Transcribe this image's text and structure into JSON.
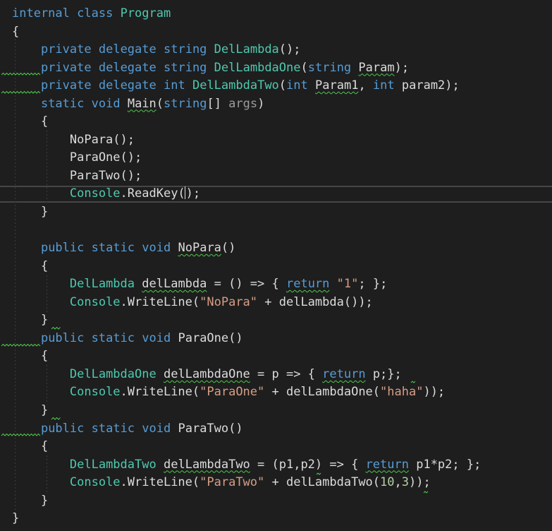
{
  "editor": {
    "lines": [
      [
        {
          "t": "internal",
          "c": "kw"
        },
        {
          "t": " "
        },
        {
          "t": "class",
          "c": "kw"
        },
        {
          "t": " "
        },
        {
          "t": "Program",
          "c": "ty"
        }
      ],
      [
        {
          "t": "{"
        }
      ],
      [
        {
          "t": "    "
        },
        {
          "t": "private",
          "c": "kw"
        },
        {
          "t": " "
        },
        {
          "t": "delegate",
          "c": "kw"
        },
        {
          "t": " "
        },
        {
          "t": "string",
          "c": "kw"
        },
        {
          "t": " "
        },
        {
          "t": "DelLambda",
          "c": "ty"
        },
        {
          "t": "();"
        }
      ],
      [
        {
          "t": "    "
        },
        {
          "t": "private",
          "c": "kw"
        },
        {
          "t": " "
        },
        {
          "t": "delegate",
          "c": "kw"
        },
        {
          "t": " "
        },
        {
          "t": "string",
          "c": "kw"
        },
        {
          "t": " "
        },
        {
          "t": "DelLambdaOne",
          "c": "ty"
        },
        {
          "t": "("
        },
        {
          "t": "string",
          "c": "kw"
        },
        {
          "t": " "
        },
        {
          "t": "Param",
          "sq": true
        },
        {
          "t": ");"
        }
      ],
      [
        {
          "t": "    "
        },
        {
          "t": "private",
          "c": "kw"
        },
        {
          "t": " "
        },
        {
          "t": "delegate",
          "c": "kw"
        },
        {
          "t": " "
        },
        {
          "t": "int",
          "c": "kw"
        },
        {
          "t": " "
        },
        {
          "t": "DelLambdaTwo",
          "c": "ty"
        },
        {
          "t": "("
        },
        {
          "t": "int",
          "c": "kw"
        },
        {
          "t": " "
        },
        {
          "t": "Param1",
          "sq": true
        },
        {
          "t": ", "
        },
        {
          "t": "int",
          "c": "kw"
        },
        {
          "t": " param2);"
        }
      ],
      [
        {
          "t": "    "
        },
        {
          "t": "static",
          "c": "kw"
        },
        {
          "t": " "
        },
        {
          "t": "void",
          "c": "kw"
        },
        {
          "t": " "
        },
        {
          "t": "Main",
          "sq": true
        },
        {
          "t": "("
        },
        {
          "t": "string",
          "c": "kw"
        },
        {
          "t": "[] "
        },
        {
          "t": "args",
          "c": "gr"
        },
        {
          "t": ")"
        }
      ],
      [
        {
          "t": "    {"
        }
      ],
      [
        {
          "t": "        NoPara();"
        }
      ],
      [
        {
          "t": "        ParaOne();"
        }
      ],
      [
        {
          "t": "        ParaTwo();"
        }
      ],
      [
        {
          "t": "        "
        },
        {
          "t": "Console",
          "c": "ty"
        },
        {
          "t": ".ReadKey("
        },
        {
          "caret": true
        },
        {
          "t": ");"
        }
      ],
      [
        {
          "t": "    }"
        }
      ],
      [
        {
          "t": ""
        }
      ],
      [
        {
          "t": "    "
        },
        {
          "t": "public",
          "c": "kw"
        },
        {
          "t": " "
        },
        {
          "t": "static",
          "c": "kw"
        },
        {
          "t": " "
        },
        {
          "t": "void",
          "c": "kw"
        },
        {
          "t": " "
        },
        {
          "t": "NoPara",
          "sq": true
        },
        {
          "t": "()"
        }
      ],
      [
        {
          "t": "    {"
        }
      ],
      [
        {
          "t": "        "
        },
        {
          "t": "DelLambda",
          "c": "ty"
        },
        {
          "t": " "
        },
        {
          "t": "delLambda",
          "sq": true
        },
        {
          "t": " = () => { "
        },
        {
          "t": "return",
          "c": "kw",
          "sq": true
        },
        {
          "t": " "
        },
        {
          "t": "\"1\"",
          "c": "st"
        },
        {
          "t": "; };"
        }
      ],
      [
        {
          "t": "        "
        },
        {
          "t": "Console",
          "c": "ty"
        },
        {
          "t": ".WriteLine("
        },
        {
          "t": "\"NoPara\"",
          "c": "st"
        },
        {
          "t": " + delLambda());"
        }
      ],
      [
        {
          "t": "    }"
        }
      ],
      [
        {
          "t": "    "
        },
        {
          "t": "public",
          "c": "kw"
        },
        {
          "t": " "
        },
        {
          "t": "static",
          "c": "kw"
        },
        {
          "t": " "
        },
        {
          "t": "void",
          "c": "kw"
        },
        {
          "t": " ParaOne()"
        }
      ],
      [
        {
          "t": "    {"
        }
      ],
      [
        {
          "t": "        "
        },
        {
          "t": "DelLambdaOne",
          "c": "ty"
        },
        {
          "t": " "
        },
        {
          "t": "delLambdaOne",
          "sq": true
        },
        {
          "t": " = p => { "
        },
        {
          "t": "return",
          "c": "kw",
          "sq": true
        },
        {
          "t": " p;};"
        }
      ],
      [
        {
          "t": "        "
        },
        {
          "t": "Console",
          "c": "ty"
        },
        {
          "t": ".WriteLine("
        },
        {
          "t": "\"ParaOne\"",
          "c": "st"
        },
        {
          "t": " + delLambdaOne("
        },
        {
          "t": "\"haha\"",
          "c": "st"
        },
        {
          "t": "));"
        }
      ],
      [
        {
          "t": "    }"
        }
      ],
      [
        {
          "t": "    "
        },
        {
          "t": "public",
          "c": "kw"
        },
        {
          "t": " "
        },
        {
          "t": "static",
          "c": "kw"
        },
        {
          "t": " "
        },
        {
          "t": "void",
          "c": "kw"
        },
        {
          "t": " ParaTwo()"
        }
      ],
      [
        {
          "t": "    {"
        }
      ],
      [
        {
          "t": "        "
        },
        {
          "t": "DelLambdaTwo",
          "c": "ty"
        },
        {
          "t": " "
        },
        {
          "t": "delLambdaTwo",
          "sq": true
        },
        {
          "t": " = (p1,p2) => { "
        },
        {
          "t": "return",
          "c": "kw",
          "sq": true
        },
        {
          "t": " p1*p2; };"
        }
      ],
      [
        {
          "t": "        "
        },
        {
          "t": "Console",
          "c": "ty"
        },
        {
          "t": ".WriteLine("
        },
        {
          "t": "\"ParaTwo\"",
          "c": "st"
        },
        {
          "t": " + delLambdaTwo("
        },
        {
          "t": "10",
          "c": "nu"
        },
        {
          "t": ","
        },
        {
          "t": "3",
          "c": "nu"
        },
        {
          "t": "));"
        }
      ],
      [
        {
          "t": "    }"
        }
      ],
      [
        {
          "t": "}"
        }
      ]
    ]
  }
}
